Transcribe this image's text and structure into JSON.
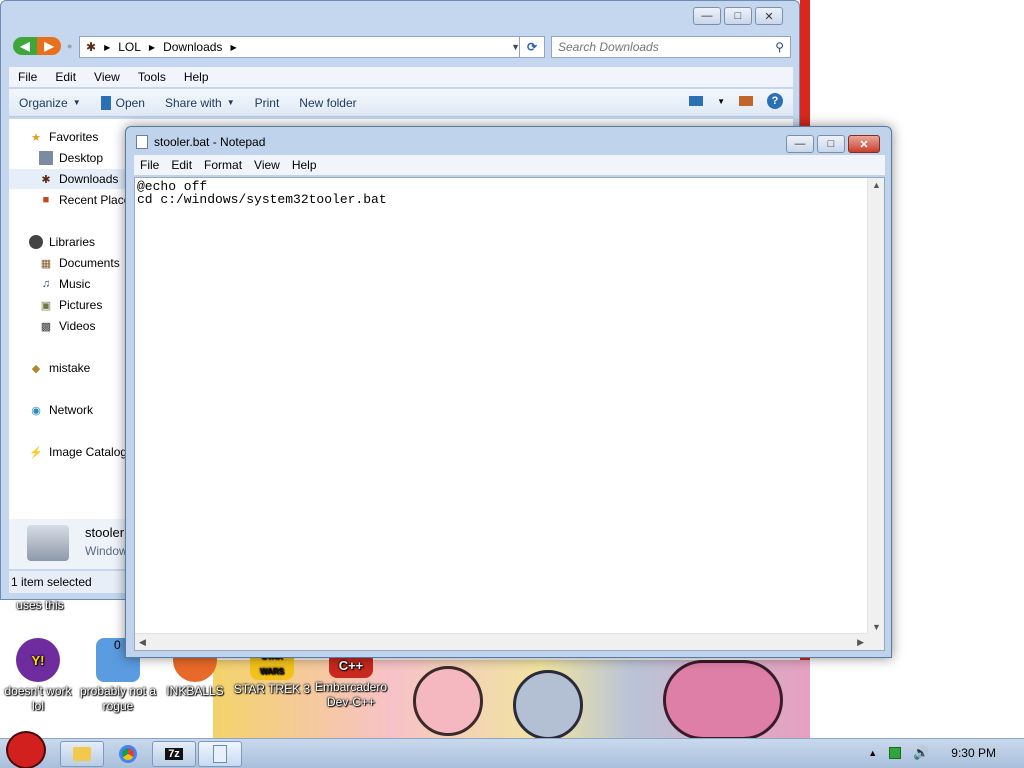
{
  "explorer": {
    "breadcrumb": [
      "LOL",
      "Downloads"
    ],
    "search_placeholder": "Search Downloads",
    "menu": [
      "File",
      "Edit",
      "View",
      "Tools",
      "Help"
    ],
    "toolbar": {
      "organize": "Organize",
      "open": "Open",
      "share_with": "Share with",
      "print": "Print",
      "new_folder": "New folder"
    },
    "sidebar": {
      "favorites": "Favorites",
      "desktop": "Desktop",
      "downloads": "Downloads",
      "recent_places": "Recent Places",
      "libraries": "Libraries",
      "documents": "Documents",
      "music": "Music",
      "pictures": "Pictures",
      "videos": "Videos",
      "mistake": "mistake",
      "network": "Network",
      "image_catalog": "Image Catalog"
    },
    "details": {
      "file_name": "stooler",
      "file_type": "Window"
    },
    "status": "1 item selected"
  },
  "notepad": {
    "title": "stooler.bat - Notepad",
    "menu": [
      "File",
      "Edit",
      "Format",
      "View",
      "Help"
    ],
    "text": "@echo off\ncd c:/windows/system32tooler.bat"
  },
  "desktop": {
    "partial_label": "uses this",
    "icons": [
      {
        "label": "doesn't work lol"
      },
      {
        "label": "probably not a rogue"
      },
      {
        "label": "INKBALLS"
      },
      {
        "label": "STAR TREK 3"
      },
      {
        "label": "Embarcadero Dev-C++"
      }
    ],
    "cpp_badge": "C++",
    "star_wars_badge": "STAR WARS",
    "zero_digit": "0"
  },
  "taskbar": {
    "seven_zip": "7z",
    "clock": "9:30 PM"
  }
}
